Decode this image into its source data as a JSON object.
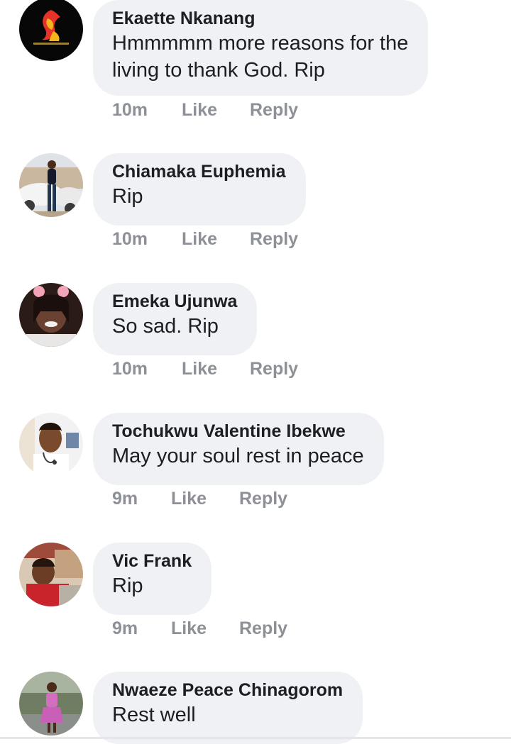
{
  "comments": [
    {
      "author": "Ekaette Nkanang",
      "text_lines": [
        "Hmmmmm more reasons for the",
        "living to thank God. Rip"
      ],
      "time": "10m",
      "like_label": "Like",
      "reply_label": "Reply",
      "avatar_icon": "avatar-logo-icon"
    },
    {
      "author": "Chiamaka Euphemia",
      "text_lines": [
        "Rip"
      ],
      "time": "10m",
      "like_label": "Like",
      "reply_label": "Reply",
      "avatar_icon": "avatar-photo-icon"
    },
    {
      "author": "Emeka Ujunwa",
      "text_lines": [
        "So sad. Rip"
      ],
      "time": "10m",
      "like_label": "Like",
      "reply_label": "Reply",
      "avatar_icon": "avatar-photo-icon"
    },
    {
      "author": "Tochukwu Valentine Ibekwe",
      "text_lines": [
        "May your soul rest in peace"
      ],
      "time": "9m",
      "like_label": "Like",
      "reply_label": "Reply",
      "avatar_icon": "avatar-photo-icon"
    },
    {
      "author": "Vic Frank",
      "text_lines": [
        "Rip"
      ],
      "time": "9m",
      "like_label": "Like",
      "reply_label": "Reply",
      "avatar_icon": "avatar-photo-icon"
    },
    {
      "author": "Nwaeze Peace Chinagorom",
      "text_lines": [
        "Rest well"
      ],
      "time": "",
      "like_label": "",
      "reply_label": "",
      "avatar_icon": "avatar-photo-icon"
    }
  ],
  "colors": {
    "bubble_bg": "#f0f1f4",
    "meta_text": "#8d9096",
    "primary_text": "#1c1e21"
  }
}
